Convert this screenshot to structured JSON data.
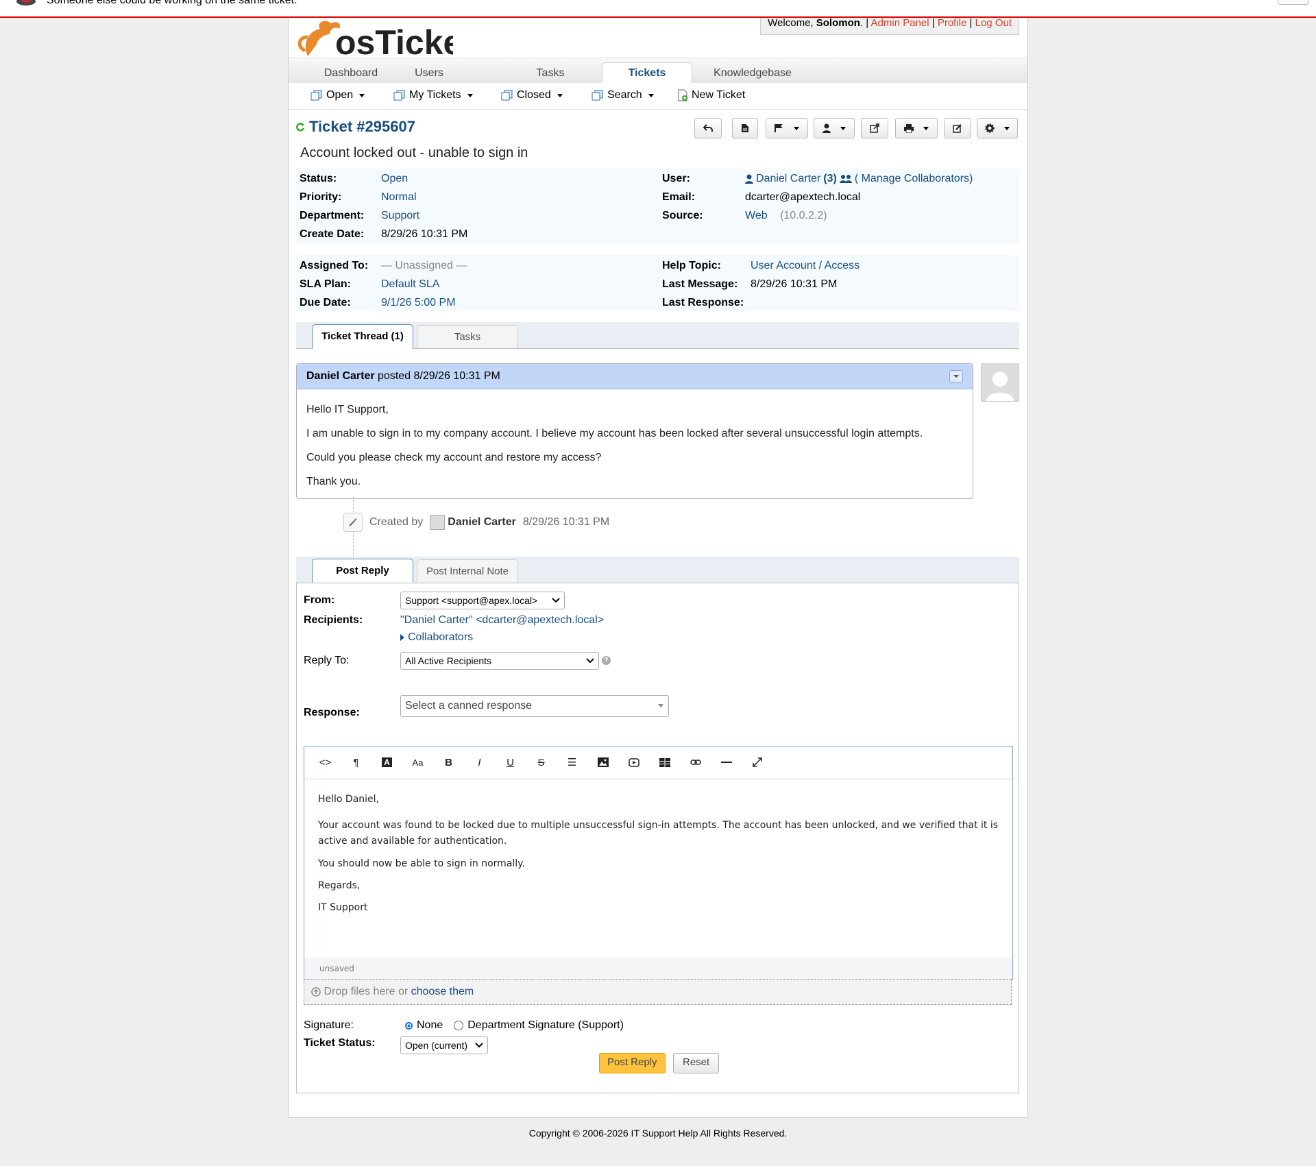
{
  "notice": {
    "message": "Someone else could be working on the same ticket."
  },
  "header": {
    "welcome_prefix": "Welcome,",
    "username": "Solomon",
    "admin_panel": "Admin Panel",
    "profile": "Profile",
    "logout": "Log Out",
    "separator": "|",
    "logo_text": "osTicket"
  },
  "nav": {
    "tabs": [
      "Dashboard",
      "Users",
      "Tasks",
      "Tickets",
      "Knowledgebase"
    ],
    "active": "Tickets"
  },
  "subnav": {
    "items": [
      "Open",
      "My Tickets",
      "Closed",
      "Search",
      "New Ticket"
    ]
  },
  "ticket": {
    "number": "Ticket #295607",
    "subject": "Account locked out - unable to sign in",
    "status_label": "Status:",
    "status": "Open",
    "priority_label": "Priority:",
    "priority": "Normal",
    "department_label": "Department:",
    "department": "Support",
    "create_date_label": "Create Date:",
    "create_date": "8/29/26 10:31 PM",
    "user_label": "User:",
    "user": "Daniel Carter",
    "user_count": "(3)",
    "manage_collaborators": "( Manage Collaborators)",
    "email_label": "Email:",
    "email": "dcarter@apextech.local",
    "source_label": "Source:",
    "source": "Web",
    "source_ip": "(10.0.2.2)",
    "assigned_label": "Assigned To:",
    "assigned": "— Unassigned —",
    "sla_label": "SLA Plan:",
    "sla": "Default SLA",
    "due_label": "Due Date:",
    "due": "9/1/26 5:00 PM",
    "help_topic_label": "Help Topic:",
    "help_topic": "User Account / Access",
    "last_message_label": "Last Message:",
    "last_message": "8/29/26 10:31 PM",
    "last_response_label": "Last Response:",
    "last_response": ""
  },
  "thread_tabs": [
    "Ticket Thread (1)",
    "Tasks"
  ],
  "thread": {
    "author": "Daniel Carter",
    "posted": "posted 8/29/26 10:31 PM",
    "body": [
      "Hello IT Support,",
      "I am unable to sign in to my company account. I believe my account has been locked after several unsuccessful login attempts.",
      "Could you please check my account and restore my access?",
      "Thank you."
    ]
  },
  "event": {
    "prefix": "Created by",
    "author": "Daniel Carter",
    "time": "8/29/26 10:31 PM"
  },
  "reply_tabs": [
    "Post Reply",
    "Post Internal Note"
  ],
  "reply": {
    "from_label": "From:",
    "from_value": "Support <support@apex.local>",
    "recipients_label": "Recipients:",
    "recipients": "\"Daniel Carter\" <dcarter@apextech.local>",
    "collaborators": "Collaborators",
    "reply_to_label": "Reply To:",
    "reply_to_value": "All Active Recipients",
    "response_label": "Response:",
    "response_placeholder": "Select a canned response",
    "editor_body": [
      "Hello Daniel,",
      "Your account was found to be locked due to multiple unsuccessful sign-in attempts. The account has been unlocked, and we verified that it is active and available for authentication.",
      "You should now be able to sign in normally.",
      "Regards,",
      "IT Support"
    ],
    "editor_status": "unsaved",
    "drop_text": "Drop files here or",
    "drop_link": "choose them",
    "signature_label": "Signature:",
    "signature_none": "None",
    "signature_dept": "Department Signature (Support)",
    "ticket_status_label": "Ticket Status:",
    "ticket_status_value": "Open (current)",
    "post_button": "Post Reply",
    "reset_button": "Reset"
  },
  "footer": {
    "copyright": "Copyright © 2006-2026 IT Support Help All Rights Reserved."
  },
  "colors": {
    "link": "#184e81",
    "accent_orange": "#ffc23d",
    "thread_header": "#c2d7f7",
    "notice_border": "#e00000",
    "header_red": "#d64027"
  }
}
